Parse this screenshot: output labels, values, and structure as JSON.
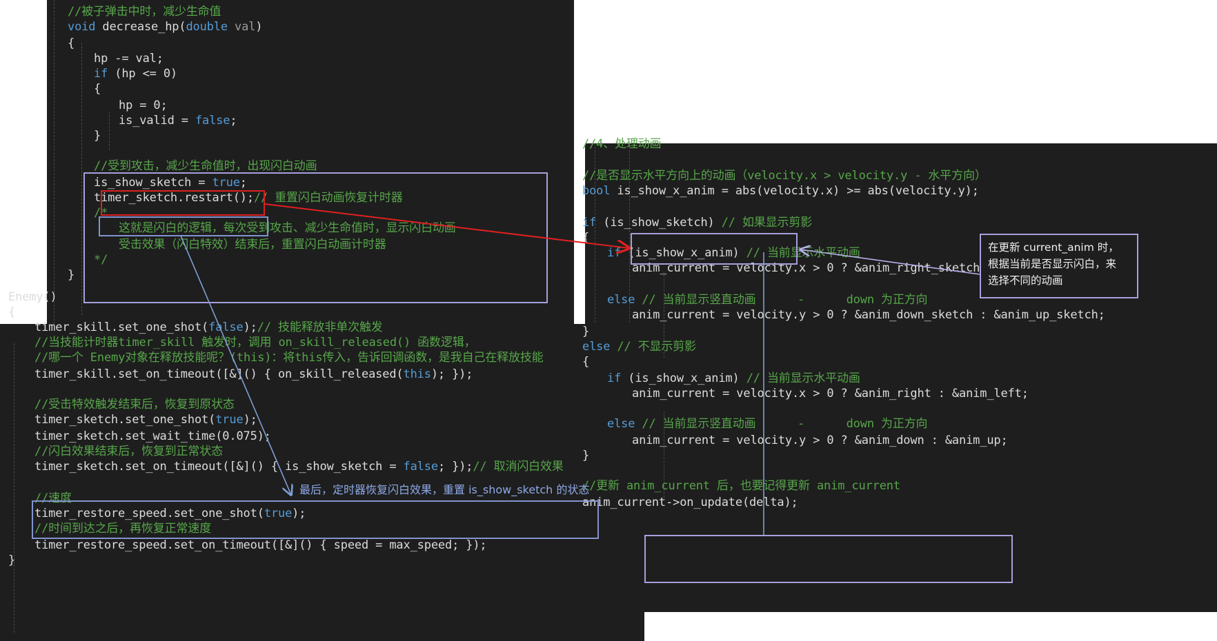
{
  "panels": {
    "top_left": {
      "lines": [
        [
          [
            "cm",
            "//被子弹击中时，减少生命值"
          ]
        ],
        [
          [
            "kw",
            "void"
          ],
          [
            "df",
            " decrease_hp("
          ],
          [
            "kw",
            "double"
          ],
          [
            "gy",
            " val"
          ],
          [
            "df",
            ")"
          ]
        ],
        [
          [
            "df",
            "{"
          ]
        ],
        [
          [
            "df",
            "hp -= val;"
          ]
        ],
        [
          [
            "kw",
            "if"
          ],
          [
            "df",
            " (hp <= 0)"
          ]
        ],
        [
          [
            "df",
            "{"
          ]
        ],
        [
          [
            "df",
            "hp = 0;"
          ]
        ],
        [
          [
            "df",
            "is_valid = "
          ],
          [
            "kw",
            "false"
          ],
          [
            "df",
            ";"
          ]
        ],
        [
          [
            "df",
            "}"
          ]
        ],
        [
          [
            "cm",
            "//受到攻击，减少生命值时，出现闪白动画"
          ]
        ],
        [
          [
            "df",
            "is_show_sketch = "
          ],
          [
            "kw",
            "true"
          ],
          [
            "df",
            ";"
          ]
        ],
        [
          [
            "df",
            "timer_sketch.restart();"
          ],
          [
            "cm",
            "// 重置闪白动画恢复计时器"
          ]
        ],
        [
          [
            "cm",
            "/*"
          ]
        ],
        [
          [
            "cm",
            "这就是闪白的逻辑，每次受到攻击、减少生命值时，显示闪白动画"
          ]
        ],
        [
          [
            "cm",
            "受击效果（闪白特效）结束后，重置闪白动画计时器"
          ]
        ],
        [
          [
            "cm",
            "*/"
          ]
        ],
        [
          [
            "df",
            "}"
          ]
        ]
      ]
    },
    "bottom_left": {
      "lines": [
        [
          [
            "df",
            "Enemy()"
          ]
        ],
        [
          [
            "df",
            "{"
          ]
        ],
        [
          [
            "df",
            "timer_skill.set_one_shot("
          ],
          [
            "kw",
            "false"
          ],
          [
            "df",
            ");"
          ],
          [
            "cm",
            "// 技能释放非单次触发"
          ]
        ],
        [
          [
            "cm",
            "//当技能计时器timer_skill 触发时，调用 on_skill_released() 函数逻辑，"
          ]
        ],
        [
          [
            "cm",
            "//哪一个 Enemy对象在释放技能呢？(this)：将this传入，告诉回调函数，是我自己在释放技能"
          ]
        ],
        [
          [
            "df",
            "timer_skill.set_on_timeout([&]() { on_skill_released("
          ],
          [
            "kw",
            "this"
          ],
          [
            "df",
            "); });"
          ]
        ],
        [
          [
            "df",
            ""
          ]
        ],
        [
          [
            "cm",
            "//受击特效触发结束后，恢复到原状态"
          ]
        ],
        [
          [
            "df",
            "timer_sketch.set_one_shot("
          ],
          [
            "kw",
            "true"
          ],
          [
            "df",
            ");"
          ]
        ],
        [
          [
            "df",
            "timer_sketch.set_wait_time(0.075);"
          ]
        ],
        [
          [
            "cm",
            "//闪白效果结束后，恢复到正常状态"
          ]
        ],
        [
          [
            "df",
            "timer_sketch.set_on_timeout([&]() { is_show_sketch = "
          ],
          [
            "kw",
            "false"
          ],
          [
            "df",
            "; });"
          ],
          [
            "cm",
            "// 取消闪白效果"
          ]
        ],
        [
          [
            "df",
            ""
          ]
        ],
        [
          [
            "cm",
            "//速度"
          ]
        ],
        [
          [
            "df",
            "timer_restore_speed.set_one_shot("
          ],
          [
            "kw",
            "true"
          ],
          [
            "df",
            ");"
          ]
        ],
        [
          [
            "cm",
            "//时间到达之后，再恢复正常速度"
          ]
        ],
        [
          [
            "df",
            "timer_restore_speed.set_on_timeout([&]() { speed = max_speed; });"
          ]
        ],
        [
          [
            "df",
            "}"
          ]
        ]
      ]
    },
    "right": {
      "lines": [
        [
          [
            "cm",
            "//4、处理动画"
          ]
        ],
        [
          [
            "df",
            ""
          ]
        ],
        [
          [
            "cm",
            "//是否显示水平方向上的动画（velocity.x > velocity.y - 水平方向）"
          ]
        ],
        [
          [
            "kw",
            "bool"
          ],
          [
            "df",
            " is_show_x_anim = abs(velocity.x) >= abs(velocity.y);"
          ]
        ],
        [
          [
            "df",
            ""
          ]
        ],
        [
          [
            "kw",
            "if"
          ],
          [
            "df",
            " (is_show_sketch) "
          ],
          [
            "cm",
            "// 如果显示剪影"
          ]
        ],
        [
          [
            "df",
            "{"
          ]
        ],
        [
          [
            "kw",
            "if"
          ],
          [
            "df",
            " (is_show_x_anim) "
          ],
          [
            "cm",
            "// 当前显示水平动画"
          ]
        ],
        [
          [
            "df",
            "anim_current = velocity.x > 0 ? &anim_right_sketch : &anim_left_sketch;"
          ]
        ],
        [
          [
            "df",
            ""
          ]
        ],
        [
          [
            "kw",
            "else"
          ],
          [
            "cm",
            " // 当前显示竖直动画      -      down 为正方向"
          ]
        ],
        [
          [
            "df",
            "anim_current = velocity.y > 0 ? &anim_down_sketch : &anim_up_sketch;"
          ]
        ],
        [
          [
            "df",
            "}"
          ]
        ],
        [
          [
            "kw",
            "else"
          ],
          [
            "cm",
            " // 不显示剪影"
          ]
        ],
        [
          [
            "df",
            "{"
          ]
        ],
        [
          [
            "kw",
            "if"
          ],
          [
            "df",
            " (is_show_x_anim) "
          ],
          [
            "cm",
            "// 当前显示水平动画"
          ]
        ],
        [
          [
            "df",
            "anim_current = velocity.x > 0 ? &anim_right : &anim_left;"
          ]
        ],
        [
          [
            "df",
            ""
          ]
        ],
        [
          [
            "kw",
            "else"
          ],
          [
            "cm",
            " // 当前显示竖直动画      -      down 为正方向"
          ]
        ],
        [
          [
            "df",
            "anim_current = velocity.y > 0 ? &anim_down : &anim_up;"
          ]
        ],
        [
          [
            "df",
            "}"
          ]
        ],
        [
          [
            "df",
            ""
          ]
        ],
        [
          [
            "cm",
            "//更新 anim_current 后，也要记得更新 anim_current"
          ]
        ],
        [
          [
            "df",
            "anim_current->on_update(delta);"
          ]
        ]
      ]
    }
  },
  "annotations": {
    "note_box": "在更新 current_anim 时，\n根据当前是否显示闪白，来\n选择不同的动画",
    "timer_note": "最后，定时器恢复闪白效果，重置 is_show_sketch 的状态"
  },
  "colors": {
    "editor_bg": "#1e1e1e",
    "comment": "#57a64a",
    "keyword": "#569cd6",
    "default": "#dcdcdc",
    "param": "#9b9b9b",
    "box_blue": "#8294d0",
    "box_purple": "#a7a1de",
    "box_red": "#e02020",
    "arrow_red": "#e02020",
    "arrow_blue": "#7f9fd6"
  }
}
